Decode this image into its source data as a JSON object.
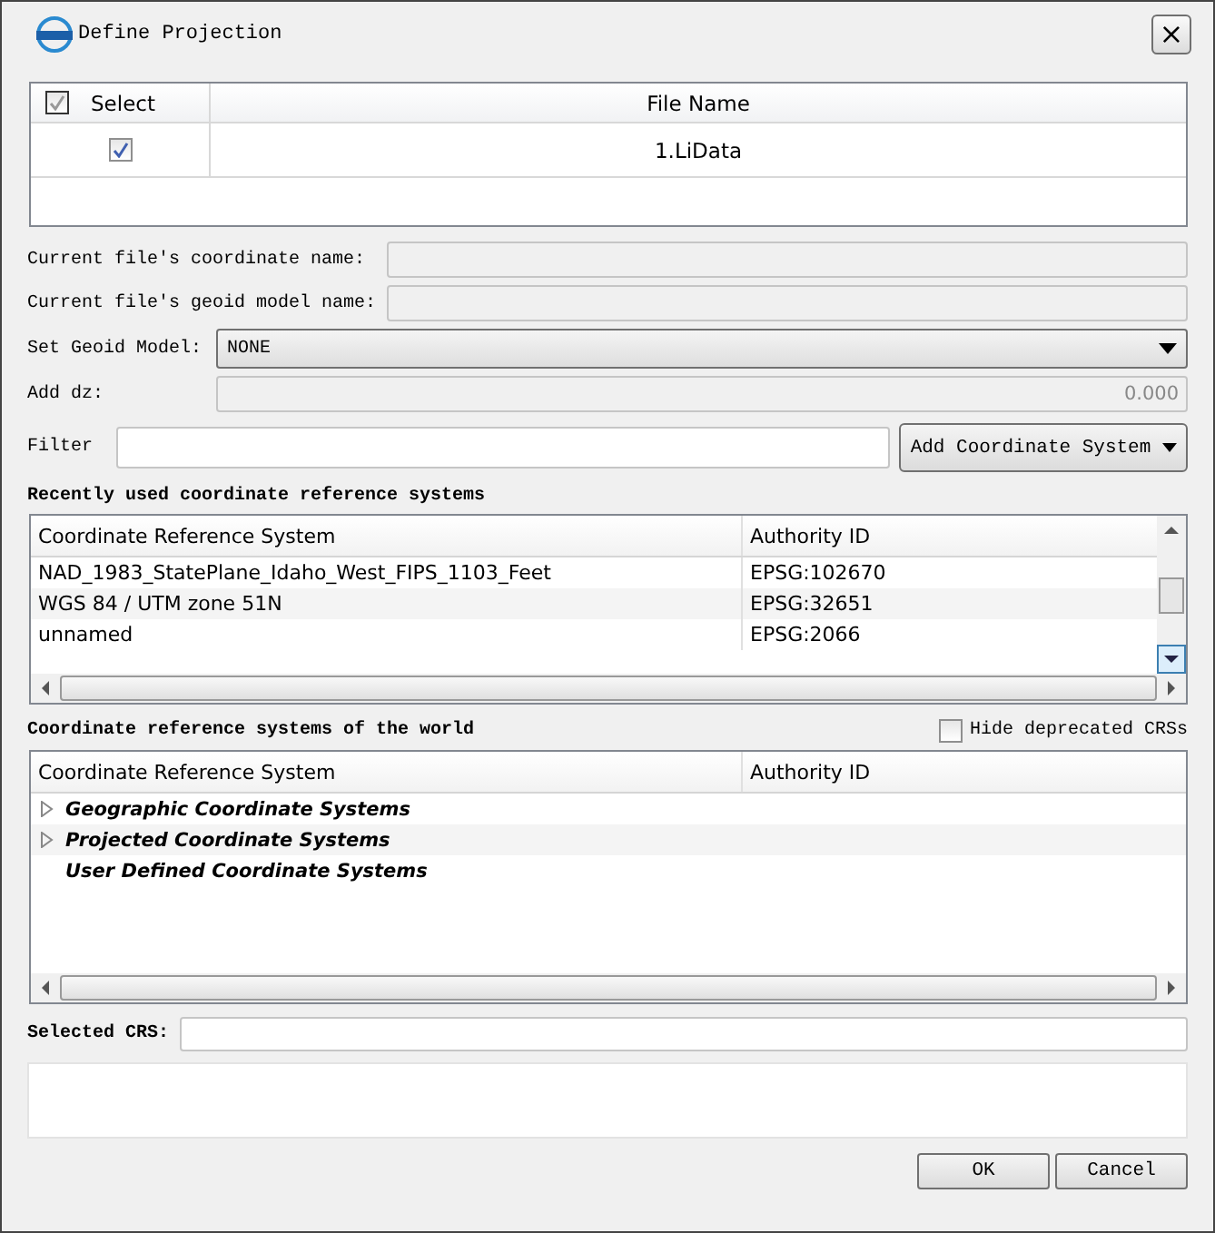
{
  "window": {
    "title": "Define Projection",
    "close": "×"
  },
  "files": {
    "columns": [
      "Select",
      "File Name"
    ],
    "header_checked": true,
    "rows": [
      {
        "checked": true,
        "name": "1.LiData"
      }
    ]
  },
  "fields": [
    {
      "kind": "text",
      "label": "Current file's coordinate name:",
      "disabled": true
    },
    {
      "kind": "text",
      "label": "Current file's geoid model name:",
      "disabled": true
    },
    {
      "kind": "select",
      "label": "Set Geoid Model:",
      "value": "NONE"
    },
    {
      "kind": "number",
      "label": "Add dz:",
      "value": "0.000",
      "disabled": true
    }
  ],
  "filter": {
    "label": "Filter",
    "button": "Add Coordinate System"
  },
  "recent": {
    "title": "Recently used coordinate reference systems",
    "columns": [
      "Coordinate Reference System",
      "Authority ID"
    ],
    "rows": [
      {
        "name": "NAD_1983_StatePlane_Idaho_West_FIPS_1103_Feet",
        "id": "EPSG:102670"
      },
      {
        "name": "WGS 84 / UTM zone 51N",
        "id": "EPSG:32651"
      },
      {
        "name": "unnamed",
        "id": "EPSG:2066"
      }
    ]
  },
  "world": {
    "title": "Coordinate reference systems of the world",
    "hide_deprecated": {
      "label": "Hide deprecated CRSs",
      "checked": false
    },
    "columns": [
      "Coordinate Reference System",
      "Authority ID"
    ],
    "items": [
      {
        "label": "Geographic Coordinate Systems",
        "expandable": true
      },
      {
        "label": "Projected Coordinate Systems",
        "expandable": true
      },
      {
        "label": "User Defined Coordinate Systems",
        "expandable": false
      }
    ]
  },
  "selected_crs": {
    "label": "Selected CRS:"
  },
  "buttons": [
    "OK",
    "Cancel"
  ]
}
